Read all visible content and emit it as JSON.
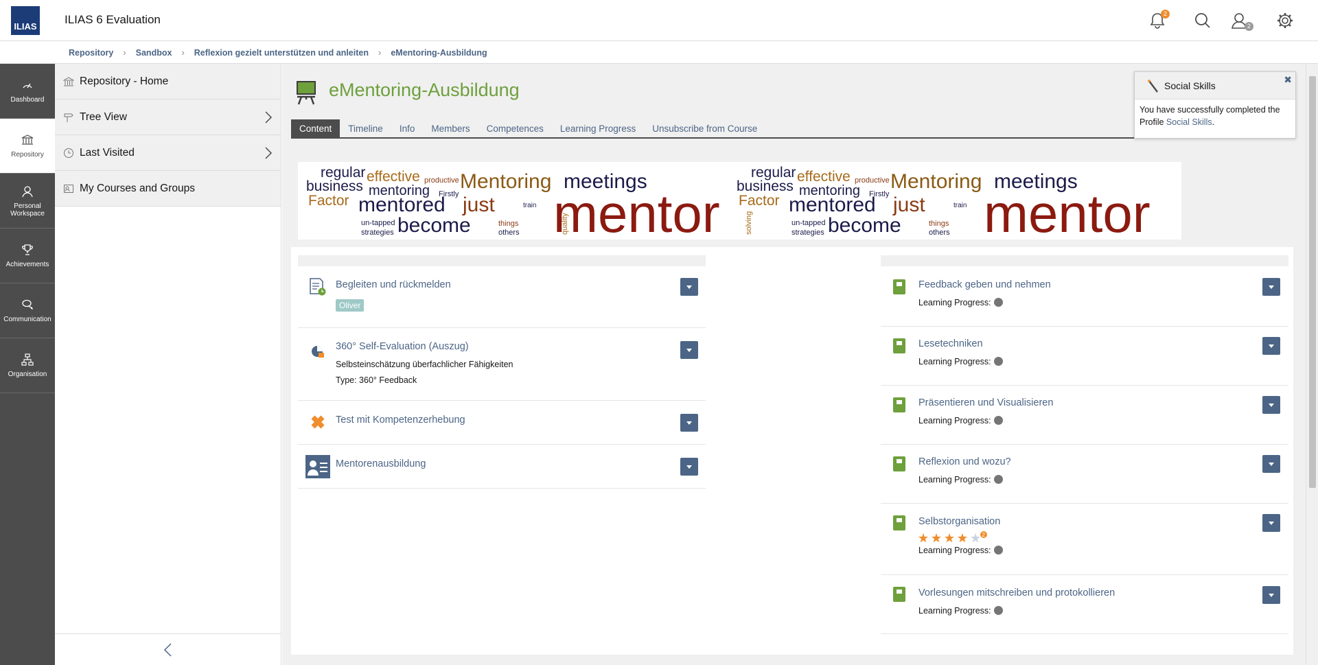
{
  "header": {
    "logo_text": "ILIAS",
    "title": "ILIAS 6 Evaluation",
    "notifications_count": "2",
    "contacts_count": "2"
  },
  "breadcrumb": [
    "Repository",
    "Sandbox",
    "Reflexion gezielt unterstützen und anleiten",
    "eMentoring-Ausbildung"
  ],
  "mainbar": [
    {
      "label": "Dashboard",
      "icon": "dashboard-icon"
    },
    {
      "label": "Repository",
      "icon": "repository-icon"
    },
    {
      "label": "Personal Workspace",
      "icon": "personal-workspace-icon"
    },
    {
      "label": "Achievements",
      "icon": "trophy-icon"
    },
    {
      "label": "Communication",
      "icon": "communication-icon"
    },
    {
      "label": "Organisation",
      "icon": "organisation-icon"
    }
  ],
  "slate": {
    "items": [
      "Repository - Home",
      "Tree View",
      "Last Visited",
      "My Courses and Groups"
    ]
  },
  "course": {
    "title": "eMentoring-Ausbildung",
    "tabs": [
      "Content",
      "Timeline",
      "Info",
      "Members",
      "Competences",
      "Learning Progress",
      "Unsubscribe from Course"
    ],
    "active_tab": "Content"
  },
  "banner": {
    "words_row1": [
      "regular",
      "effective",
      "Mentoring",
      "meetings"
    ],
    "words_row2": [
      "business",
      "productive",
      "mentoring",
      "Firstly"
    ],
    "words_row3": [
      "Factor",
      "mentored",
      "just",
      "mentor"
    ],
    "words_row4": [
      "become",
      "un-tapped",
      "strategies",
      "things",
      "others",
      "train",
      "quality",
      "solving"
    ]
  },
  "left_items": [
    {
      "title": "Begleiten und rückmelden",
      "tag": "Oliver",
      "icon": "exercise-icon"
    },
    {
      "title": "360° Self-Evaluation (Auszug)",
      "sub1": "Selbsteinschätzung überfachlicher Fähigkeiten",
      "sub2": "Type: 360° Feedback",
      "icon": "survey-icon"
    },
    {
      "title": "Test mit Kompetenzerhebung",
      "icon": "test-icon"
    },
    {
      "title": "Mentorenausbildung",
      "icon": "portfolio-icon"
    }
  ],
  "right_items": [
    {
      "title": "Feedback geben und nehmen",
      "lp": "Learning Progress:"
    },
    {
      "title": "Lesetechniken",
      "lp": "Learning Progress:"
    },
    {
      "title": "Präsentieren und Visualisieren",
      "lp": "Learning Progress:"
    },
    {
      "title": "Reflexion und wozu?",
      "lp": "Learning Progress:"
    },
    {
      "title": "Selbstorganisation",
      "lp": "Learning Progress:",
      "rating": 4,
      "rating_max": 5,
      "rating_count": "2"
    },
    {
      "title": "Vorlesungen mitschreiben und protokollieren",
      "lp": "Learning Progress:"
    }
  ],
  "popover": {
    "title": "Social Skills",
    "text": "You have successfully completed the Profile ",
    "link": "Social Skills",
    "end": "."
  },
  "colors": {
    "accent": "#4c6586",
    "course_title": "#6ea03c",
    "mainbar": "#4c4c4c",
    "badge": "#f08d2c"
  }
}
